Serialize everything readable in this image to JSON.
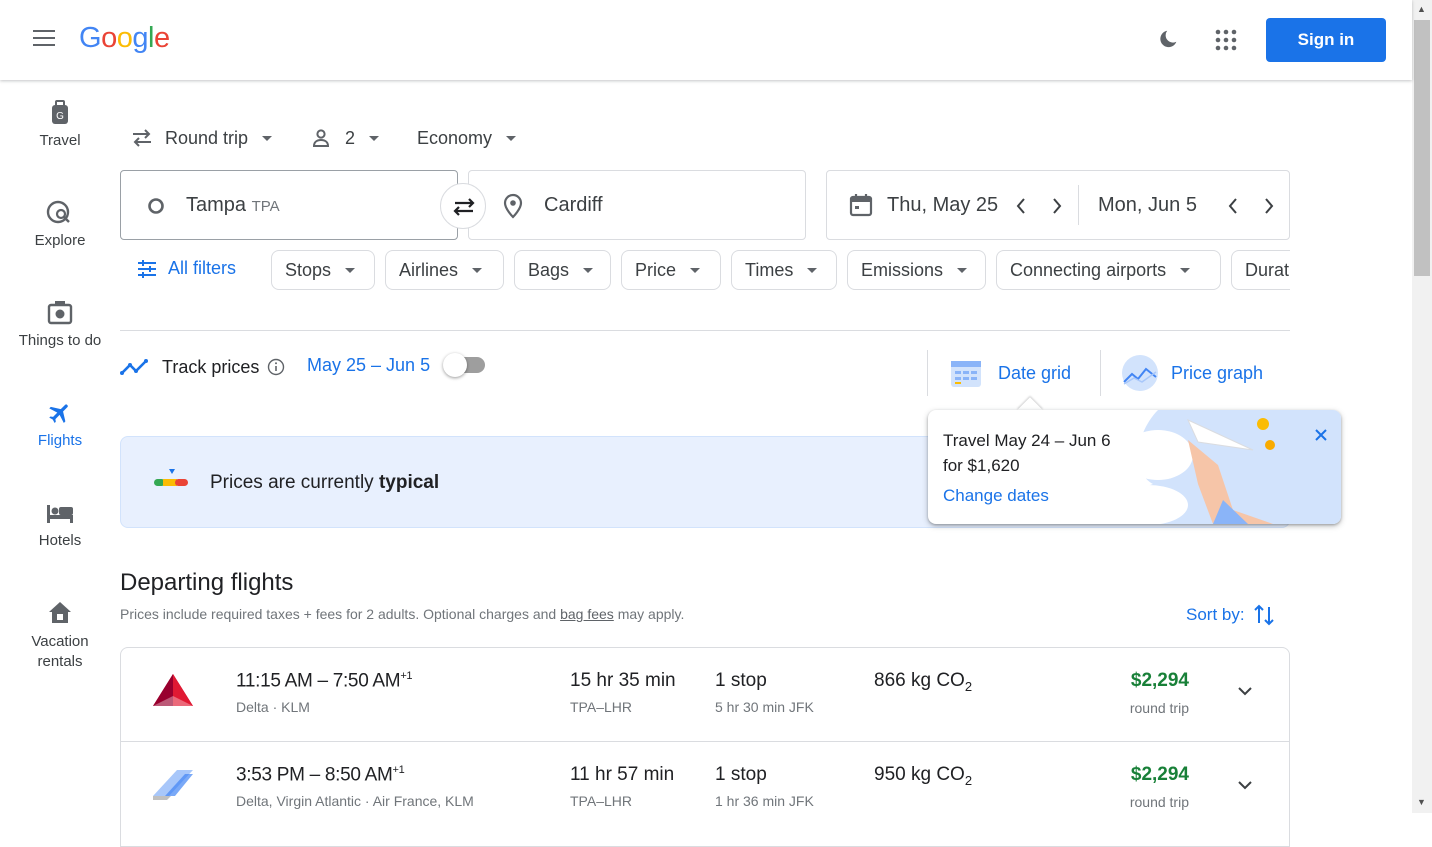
{
  "header": {
    "logo_letters": [
      {
        "ch": "G",
        "color": "#4285F4"
      },
      {
        "ch": "o",
        "color": "#EA4335"
      },
      {
        "ch": "o",
        "color": "#FBBC05"
      },
      {
        "ch": "g",
        "color": "#4285F4"
      },
      {
        "ch": "l",
        "color": "#34A853"
      },
      {
        "ch": "e",
        "color": "#EA4335"
      }
    ],
    "sign_in_label": "Sign in",
    "icons": [
      "menu-icon",
      "dark-mode-moon-icon",
      "apps-grid-icon"
    ]
  },
  "sidenav": {
    "items": [
      {
        "label": "Travel",
        "icon": "luggage-icon",
        "active": false
      },
      {
        "label": "Explore",
        "icon": "explore-globe-icon",
        "active": false
      },
      {
        "label": "Things to do",
        "icon": "camera-icon",
        "active": false
      },
      {
        "label": "Flights",
        "icon": "airplane-icon",
        "active": true
      },
      {
        "label": "Hotels",
        "icon": "bed-icon",
        "active": false
      },
      {
        "label": "Vacation rentals",
        "icon": "house-icon",
        "active": false
      }
    ]
  },
  "search": {
    "trip_type": "Round trip",
    "passengers": "2",
    "cabin_class": "Economy",
    "origin_city": "Tampa",
    "origin_code": "TPA",
    "destination": "Cardiff",
    "depart_date": "Thu, May 25",
    "return_date": "Mon, Jun 5"
  },
  "filters": {
    "all_filters_label": "All filters",
    "chips": [
      "Stops",
      "Airlines",
      "Bags",
      "Price",
      "Times",
      "Emissions",
      "Connecting airports",
      "Duration"
    ]
  },
  "tracking": {
    "label": "Track prices",
    "date_range": "May 25 – Jun 5",
    "enabled": false,
    "date_grid_label": "Date grid",
    "price_graph_label": "Price graph"
  },
  "banner": {
    "text_prefix": "Prices are currently ",
    "text_emphasis": "typical"
  },
  "popup": {
    "text": "Travel May 24 – Jun 6 for $1,620",
    "link_label": "Change dates"
  },
  "results": {
    "title": "Departing flights",
    "subtitle_prefix": "Prices include required taxes + fees for 2 adults. Optional charges and ",
    "subtitle_link": "bag fees",
    "subtitle_suffix": " may apply.",
    "sort_label": "Sort by:",
    "flights": [
      {
        "times": "11:15 AM – 7:50 AM",
        "day_offset": "+1",
        "carriers": "Delta · KLM",
        "duration": "15 hr 35 min",
        "route": "TPA–LHR",
        "stops": "1 stop",
        "layover": "5 hr 30 min JFK",
        "co2_value": "866 kg CO",
        "co2_sub": "2",
        "price": "$2,294",
        "price_type": "round trip",
        "logo": "delta-logo"
      },
      {
        "times": "3:53 PM – 8:50 AM",
        "day_offset": "+1",
        "carriers": "Delta, Virgin Atlantic · Air France, KLM",
        "duration": "11 hr 57 min",
        "route": "TPA–LHR",
        "stops": "1 stop",
        "layover": "1 hr 36 min JFK",
        "co2_value": "950 kg CO",
        "co2_sub": "2",
        "price": "$2,294",
        "price_type": "round trip",
        "logo": "multi-airline-logo"
      }
    ]
  },
  "colors": {
    "accent": "#1a73e8",
    "price_green": "#188038",
    "banner_bg": "#e8f0fe"
  }
}
